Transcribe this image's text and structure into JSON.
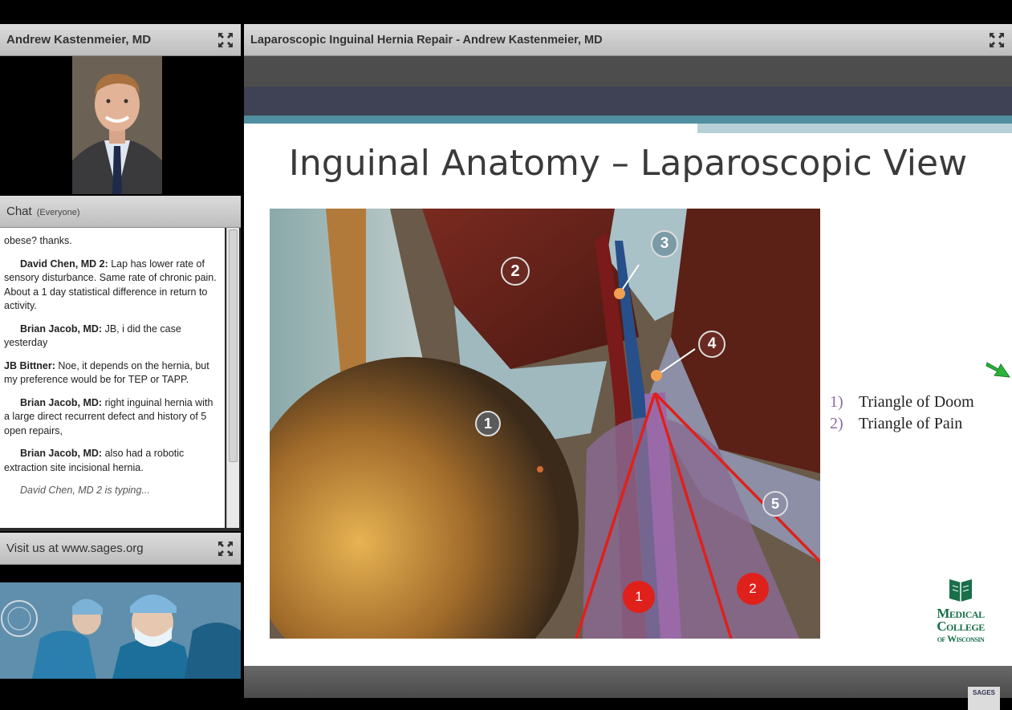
{
  "camera": {
    "title": "Andrew Kastenmeier, MD"
  },
  "chat": {
    "title": "Chat",
    "scope": "(Everyone)",
    "messages": [
      {
        "sender": "",
        "text": "obese? thanks."
      },
      {
        "sender": "David Chen, MD 2:",
        "text": "Lap has lower rate of sensory disturbance. Same rate of chronic pain. About a 1 day statistical difference in return to activity."
      },
      {
        "sender": "Brian Jacob, MD:",
        "text": "JB, i did the case yesterday"
      },
      {
        "sender": "JB Bittner:",
        "text": "Noe, it depends on the hernia, but my preference would be for TEP or TAPP."
      },
      {
        "sender": "Brian Jacob, MD:",
        "text": "right inguinal hernia with a large direct recurrent defect and history of 5 open repairs,"
      },
      {
        "sender": "Brian Jacob, MD:",
        "text": "also had a robotic extraction site incisional hernia."
      }
    ],
    "typing": "David Chen, MD 2 is typing..."
  },
  "sages_pod": {
    "title": "Visit us at www.sages.org"
  },
  "presentation": {
    "title": "Laparoscopic Inguinal Hernia Repair - Andrew Kastenmeier, MD",
    "slide_title": "Inguinal Anatomy – Laparoscopic View",
    "legend": [
      {
        "num": "1)",
        "text": "Triangle of Doom"
      },
      {
        "num": "2)",
        "text": "Triangle of Pain"
      }
    ],
    "figure_markers": [
      "1",
      "2",
      "3",
      "4",
      "5"
    ],
    "triangle_labels": [
      "1",
      "2"
    ],
    "logo": {
      "line1": "Medical",
      "line2": "College",
      "line3": "of Wisconsin"
    }
  },
  "mini_logo": "SAGES",
  "colors": {
    "header_bg": "#c8c8c8",
    "band_dark": "#3e4254",
    "band_teal": "#4f8fa0",
    "triangle_red": "#e0201b",
    "logo_green": "#1a6f4a"
  },
  "icons": {
    "maximize": "maximize-icon",
    "pointer": "green-arrow-icon"
  }
}
